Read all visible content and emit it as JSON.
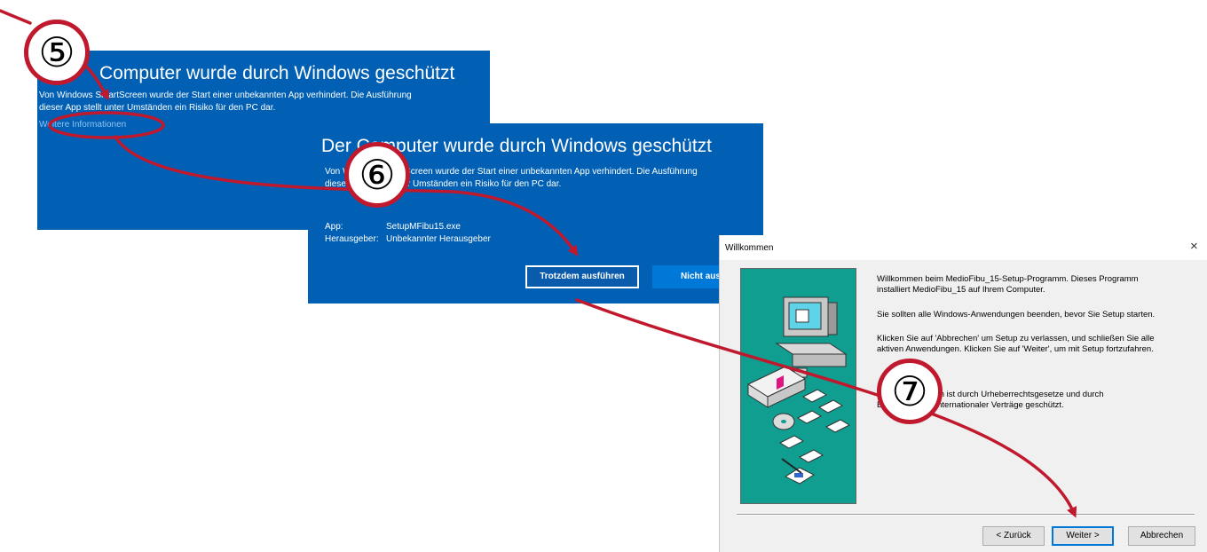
{
  "screenshot1": {
    "title": "Computer wurde durch Windows geschützt",
    "line1": "Von Windows SmartScreen wurde der Start einer unbekannten App verhindert. Die Ausführung",
    "line2": "dieser App stellt unter Umständen ein Risiko für den PC dar.",
    "more_info_link": "Weitere Informationen"
  },
  "screenshot2": {
    "title": "Der Computer wurde durch Windows geschützt",
    "line1": "Von Windows SmartScreen wurde der Start einer unbekannten App verhindert. Die Ausführung",
    "line2": "dieser App stellt unter Umständen ein Risiko für den PC dar.",
    "app_label": "App:",
    "app_value": "SetupMFibu15.exe",
    "publisher_label": "Herausgeber:",
    "publisher_value": "Unbekannter Herausgeber",
    "run_anyway_button": "Trotzdem ausführen",
    "dont_run_button": "Nicht ausführen"
  },
  "setup_dialog": {
    "title": "Willkommen",
    "close_glyph": "×",
    "p1_line1": "Willkommen beim MedioFibu_15-Setup-Programm. Dieses Programm",
    "p1_line2": "installiert MedioFibu_15 auf Ihrem Computer.",
    "p2": "Sie sollten alle Windows-Anwendungen beenden, bevor Sie Setup starten.",
    "p3_line1": "Klicken Sie auf 'Abbrechen' um Setup zu verlassen, und schließen Sie alle",
    "p3_line2": "aktiven Anwendungen. Klicken Sie auf 'Weiter', um mit Setup fortzufahren.",
    "p4_line1": "Dieses Programm ist durch Urheberrechtsgesetze und durch",
    "p4_line2": "Bestimmungen internationaler Verträge geschützt.",
    "back_button": "< Zurück",
    "next_button": "Weiter >",
    "cancel_button": "Abbrechen"
  },
  "step_markers": [
    "⑤",
    "⑥",
    "⑦"
  ],
  "colors": {
    "smartscreen_blue": "#0160b4",
    "annotation_red": "#c0192d",
    "setup_art_teal": "#0f9e8f"
  }
}
